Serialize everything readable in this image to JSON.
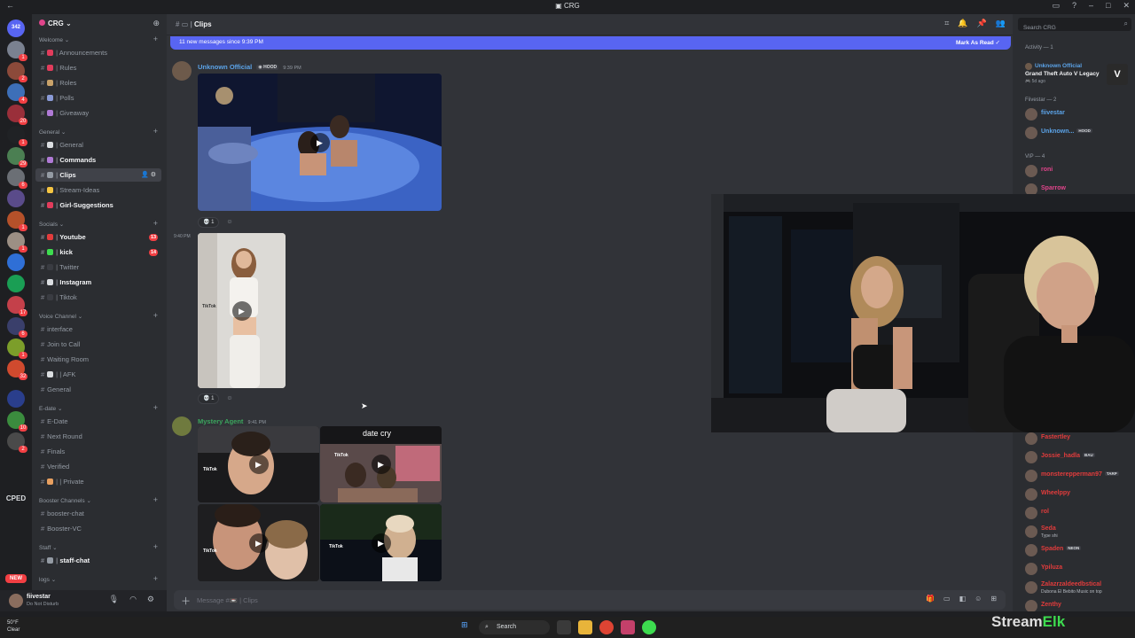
{
  "window": {
    "title": "CRG"
  },
  "guilds": {
    "items": [
      {
        "label": "342",
        "color": "#5865f2",
        "badge": ""
      },
      {
        "label": "",
        "color": "#7a8190",
        "badge": "1"
      },
      {
        "label": "",
        "color": "#8c4a3a",
        "badge": "2"
      },
      {
        "label": "",
        "color": "#3d6fb8",
        "badge": "4"
      },
      {
        "label": "",
        "color": "#9a2f3a",
        "badge": "20"
      },
      {
        "label": "",
        "color": "#202225",
        "badge": "1"
      },
      {
        "label": "",
        "color": "#4b7f52",
        "badge": "29"
      },
      {
        "label": "",
        "color": "#6b6f75",
        "badge": "6"
      },
      {
        "label": "",
        "color": "#5a4b8a",
        "badge": ""
      },
      {
        "label": "",
        "color": "#b5512a",
        "badge": "1"
      },
      {
        "label": "",
        "color": "#9c8f84",
        "badge": "1"
      },
      {
        "label": "",
        "color": "#2f6fd6",
        "badge": ""
      },
      {
        "label": "",
        "color": "#1a9e54",
        "badge": ""
      },
      {
        "label": "",
        "color": "#c4404a",
        "badge": "17"
      },
      {
        "label": "",
        "color": "#3a3f6b",
        "badge": "6"
      },
      {
        "label": "",
        "color": "#7c9e2a",
        "badge": "1"
      },
      {
        "label": "",
        "color": "#d04a2e",
        "badge": "32"
      },
      {
        "label": "",
        "color": "#2a3e8c",
        "badge": ""
      },
      {
        "label": "",
        "color": "#3b8c3e",
        "badge": "10"
      },
      {
        "label": "",
        "color": "#4a4a4a",
        "badge": "2"
      }
    ],
    "cped_label": "CPED",
    "new_label": "NEW"
  },
  "server": {
    "name": "CRG",
    "categories": [
      {
        "name": "Welcome",
        "channels": [
          {
            "name": "Announcements",
            "emoji_color": "#e23c5c",
            "state": "normal"
          },
          {
            "name": "Rules",
            "emoji_color": "#e23c5c",
            "state": "normal"
          },
          {
            "name": "Roles",
            "emoji_color": "#c9a26a",
            "state": "normal"
          },
          {
            "name": "Polls",
            "emoji_color": "#8a9ad6",
            "state": "normal"
          },
          {
            "name": "Giveaway",
            "emoji_color": "#b07ad6",
            "state": "normal"
          }
        ]
      },
      {
        "name": "General",
        "channels": [
          {
            "name": "General",
            "emoji_color": "#dbdee1",
            "state": "normal"
          },
          {
            "name": "Commands",
            "emoji_color": "#b07ad6",
            "state": "unread"
          },
          {
            "name": "Clips",
            "emoji_color": "#949ba4",
            "state": "active"
          },
          {
            "name": "Stream-Ideas",
            "emoji_color": "#f5c542",
            "state": "normal"
          },
          {
            "name": "Girl-Suggestions",
            "emoji_color": "#e23c5c",
            "state": "unread"
          }
        ]
      },
      {
        "name": "Socials",
        "channels": [
          {
            "name": "Youtube",
            "emoji_color": "#e23c3c",
            "state": "unread",
            "mentions": "13"
          },
          {
            "name": "kick",
            "emoji_color": "#3ddc4f",
            "state": "unread",
            "mentions": "14"
          },
          {
            "name": "Twitter",
            "emoji_color": "#3a3c42",
            "state": "normal"
          },
          {
            "name": "Instagram",
            "emoji_color": "#dbdee1",
            "state": "unread"
          },
          {
            "name": "Tiktok",
            "emoji_color": "#3a3c42",
            "state": "normal"
          }
        ]
      },
      {
        "name": "Voice Channel",
        "channels": [
          {
            "name": "interface",
            "emoji_color": "",
            "state": "normal"
          },
          {
            "name": "Join to Call",
            "emoji_color": "",
            "state": "normal"
          },
          {
            "name": "Waiting Room",
            "emoji_color": "",
            "state": "normal"
          },
          {
            "name": "| AFK",
            "emoji_color": "#dbdee1",
            "state": "normal"
          },
          {
            "name": "General",
            "emoji_color": "",
            "state": "normal"
          }
        ]
      },
      {
        "name": "E-date",
        "channels": [
          {
            "name": "E-Date",
            "emoji_color": "",
            "state": "normal"
          },
          {
            "name": "Next Round",
            "emoji_color": "",
            "state": "normal"
          },
          {
            "name": "Finals",
            "emoji_color": "",
            "state": "normal"
          },
          {
            "name": "Verified",
            "emoji_color": "",
            "state": "normal"
          },
          {
            "name": "| Private",
            "emoji_color": "#e8a060",
            "state": "normal"
          }
        ]
      },
      {
        "name": "Booster Channels",
        "channels": [
          {
            "name": "booster-chat",
            "emoji_color": "",
            "state": "normal"
          },
          {
            "name": "Booster-VC",
            "emoji_color": "",
            "state": "normal"
          }
        ]
      },
      {
        "name": "Staff",
        "channels": [
          {
            "name": "staff-chat",
            "emoji_color": "#949ba4",
            "state": "unread"
          }
        ]
      },
      {
        "name": "logs",
        "channels": []
      }
    ]
  },
  "user": {
    "name": "fiivestar",
    "status": "Do Not Disturb"
  },
  "channel_header": {
    "name": "Clips"
  },
  "new_messages_bar": {
    "text": "11 new messages since 9:39 PM",
    "mark_read": "Mark As Read"
  },
  "messages": [
    {
      "author": "Unknown Official",
      "author_color": "#5ba3e8",
      "tag": "HOOD",
      "time": "9:39 PM",
      "reaction_count": "1"
    },
    {
      "author": "",
      "time": "9:40 PM",
      "reaction_count": "1"
    },
    {
      "author": "Mystery Agent",
      "author_color": "#3ba55d",
      "time": "9:41 PM",
      "caption": "date cry",
      "tiktok_label": "TikTok"
    }
  ],
  "composer": {
    "placeholder": "Message #📼 | Clips"
  },
  "members": {
    "search_placeholder": "Search CRG",
    "activity_header": "Activity — 1",
    "activity": {
      "user": "Unknown Official",
      "game": "Grand Theft Auto V Legacy",
      "ago": "5d ago"
    },
    "groups": [
      {
        "header": "Fiivestar — 2",
        "members": [
          {
            "name": "fiivestar",
            "color": "#5ba3e8",
            "tag": "",
            "sub": ""
          },
          {
            "name": "Unknown...",
            "color": "#5ba3e8",
            "tag": "HOOD",
            "sub": ""
          }
        ]
      },
      {
        "header": "VIP — 4",
        "members": [
          {
            "name": "roni",
            "color": "#e0458b",
            "tag": "",
            "sub": ""
          },
          {
            "name": "Sparrow",
            "color": "#e0458b",
            "tag": "",
            "sub": ""
          }
        ]
      }
    ],
    "lower": [
      {
        "name": "Fastertley",
        "color": "#e23c3c",
        "tag": "",
        "sub": ""
      },
      {
        "name": "Jossie_hadla",
        "color": "#e23c3c",
        "tag": "BAU",
        "sub": ""
      },
      {
        "name": "monsterepperman97",
        "color": "#e23c3c",
        "tag": "TARP",
        "sub": ""
      },
      {
        "name": "Wheelppy",
        "color": "#e23c3c",
        "tag": "",
        "sub": ""
      },
      {
        "name": "rol",
        "color": "#e23c3c",
        "tag": "",
        "sub": ""
      },
      {
        "name": "Seda",
        "color": "#e23c3c",
        "tag": "",
        "sub": "Type shi"
      },
      {
        "name": "Spaden",
        "color": "#e23c3c",
        "tag": "NEON",
        "sub": ""
      },
      {
        "name": "Ypiluza",
        "color": "#e23c3c",
        "tag": "",
        "sub": ""
      },
      {
        "name": "Zalazrzaldeedbstical",
        "color": "#e23c3c",
        "tag": "",
        "sub": "Dubona El Bebito Music on top"
      },
      {
        "name": "Zenthy",
        "color": "#e23c3c",
        "tag": "",
        "sub": ""
      }
    ]
  },
  "taskbar": {
    "weather_temp": "50°F",
    "weather_desc": "Clear",
    "search_label": "Search"
  },
  "watermark": {
    "stream": "Stream",
    "elk": "Elk"
  }
}
